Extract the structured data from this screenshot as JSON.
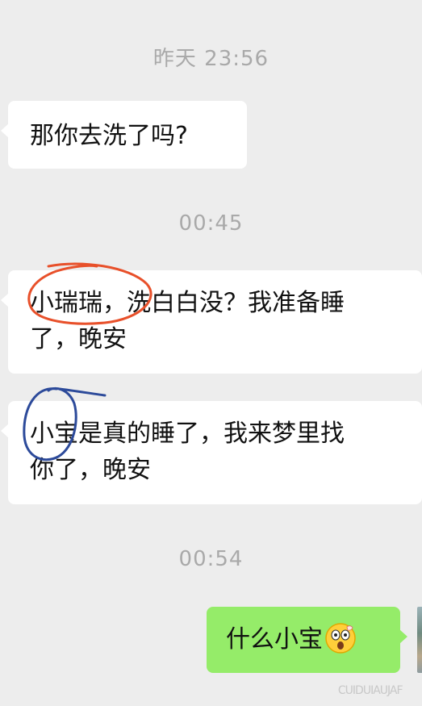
{
  "timestamps": {
    "t1": "昨天 23:56",
    "t2": "00:45",
    "t3": "00:54"
  },
  "messages": [
    {
      "side": "left",
      "text": "那你去洗了吗?"
    },
    {
      "side": "left",
      "line1": "小瑞瑞，洗白白没？我准备睡",
      "line2": "了，晚安"
    },
    {
      "side": "left",
      "line1": "小宝是真的睡了，我来梦里找",
      "line2": "你了，晚安"
    },
    {
      "side": "right",
      "text": "什么小宝",
      "emoji": "astonished-face-emoji"
    }
  ],
  "watermark": "  CUIDUIAUJAF",
  "annotations": {
    "red_circle_color": "#e8502a",
    "blue_circle_color": "#2c4a9a"
  },
  "colors": {
    "background": "#ededed",
    "left_bubble": "#ffffff",
    "right_bubble": "#95ec69"
  }
}
